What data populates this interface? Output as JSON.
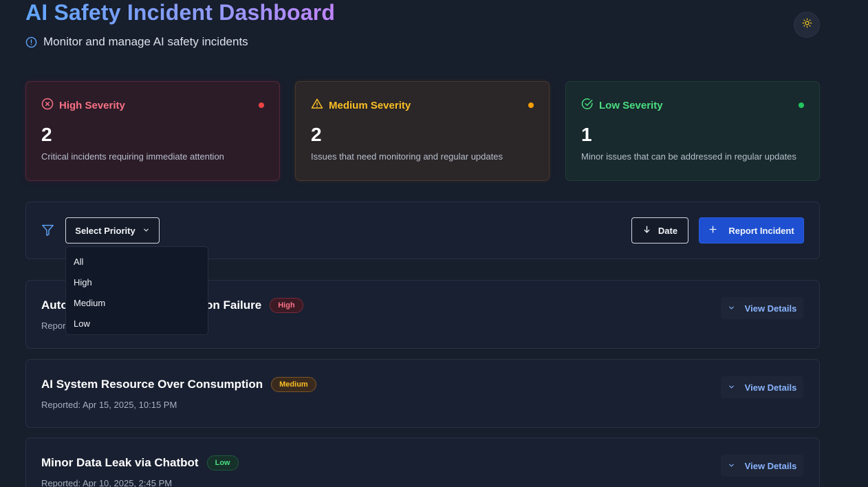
{
  "header": {
    "title": "AI Safety Incident Dashboard",
    "subtitle": "Monitor and manage AI safety incidents",
    "info_icon": "info-circle-icon",
    "theme_icon": "sun-icon"
  },
  "summary_cards": [
    {
      "label": "High Severity",
      "count": "2",
      "description": "Critical incidents requiring immediate attention",
      "icon": "x-circle-icon",
      "color": "#f87184"
    },
    {
      "label": "Medium Severity",
      "count": "2",
      "description": "Issues that need monitoring and regular updates",
      "icon": "warning-triangle-icon",
      "color": "#fbbf24"
    },
    {
      "label": "Low Severity",
      "count": "1",
      "description": "Minor issues that can be addressed in regular updates",
      "icon": "check-circle-icon",
      "color": "#4ade80"
    }
  ],
  "toolbar": {
    "filter_icon": "filter-icon",
    "select_label": "Select Priority",
    "date_label": "Date",
    "report_label": "Report Incident"
  },
  "priority_options": [
    "All",
    "High",
    "Medium",
    "Low"
  ],
  "incidents": [
    {
      "title": "Autonomous Vehicle Navigation Failure",
      "severity": "High",
      "reported": "Reported: Apr 18, 2025, 3:30 PM",
      "view_label": "View Details"
    },
    {
      "title": "AI System Resource Over Consumption",
      "severity": "Medium",
      "reported": "Reported: Apr 15, 2025, 10:15 PM",
      "view_label": "View Details"
    },
    {
      "title": "Minor Data Leak via Chatbot",
      "severity": "Low",
      "reported": "Reported: Apr 10, 2025, 2:45 PM",
      "view_label": "View Details"
    }
  ],
  "colors": {
    "background": "#171e2c",
    "accent_blue": "#1d4fd0",
    "high": "#ef4444",
    "medium": "#f59e0b",
    "low": "#22c55e"
  }
}
